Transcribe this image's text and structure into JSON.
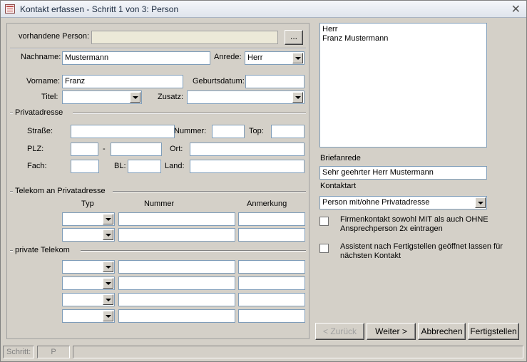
{
  "window": {
    "title": "Kontakt erfassen - Schritt 1 von 3: Person",
    "close_glyph": "✕"
  },
  "form": {
    "vorhandene_person_label": "vorhandene Person:",
    "vorhandene_person_value": "",
    "browse_label": "...",
    "nachname_label": "Nachname:",
    "nachname_value": "Mustermann",
    "anrede_label": "Anrede:",
    "anrede_value": "Herr",
    "vorname_label": "Vorname:",
    "vorname_value": "Franz",
    "geburtsdatum_label": "Geburtsdatum:",
    "geburtsdatum_value": "",
    "titel_label": "Titel:",
    "titel_value": "",
    "zusatz_label": "Zusatz:",
    "zusatz_value": ""
  },
  "privatadresse": {
    "heading": "Privatadresse",
    "strasse_label": "Straße:",
    "nummer_label": "Nummer:",
    "top_label": "Top:",
    "plz_label": "PLZ:",
    "dash": "-",
    "ort_label": "Ort:",
    "fach_label": "Fach:",
    "bl_label": "BL:",
    "land_label": "Land:"
  },
  "telekom_privat": {
    "heading": "Telekom an Privatadresse",
    "col_typ": "Typ",
    "col_nummer": "Nummer",
    "col_anmerkung": "Anmerkung"
  },
  "private_telekom": {
    "heading": "private Telekom"
  },
  "preview": {
    "line1": "Herr",
    "line2": "Franz Mustermann"
  },
  "briefanrede": {
    "label": "Briefanrede",
    "value": "Sehr geehrter Herr Mustermann"
  },
  "kontaktart": {
    "label": "Kontaktart",
    "value": "Person mit/ohne Privatadresse"
  },
  "options": {
    "firmenkontakt_label": "Firmenkontakt sowohl MIT als auch OHNE Ansprechperson 2x eintragen",
    "assistent_label": "Assistent nach Fertigstellen geöffnet lassen für nächsten Kontakt"
  },
  "buttons": {
    "back": "< Zurück",
    "next": "Weiter >",
    "cancel": "Abbrechen",
    "finish": "Fertigstellen"
  },
  "status": {
    "schritt_label": "Schritt:",
    "schritt_value": "P"
  }
}
